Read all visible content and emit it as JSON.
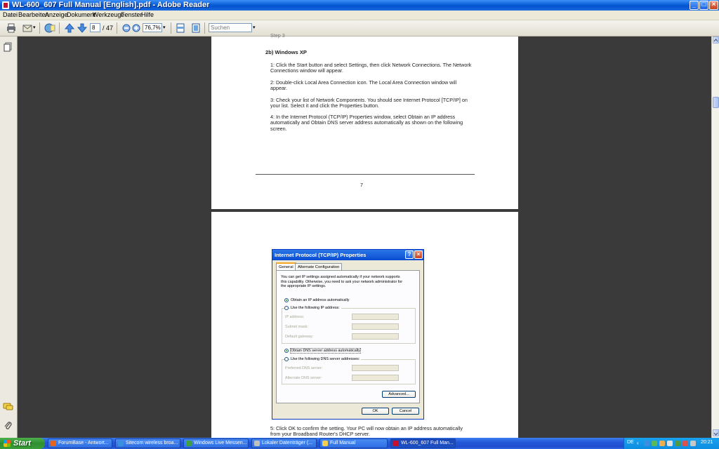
{
  "window": {
    "title": "WL-600_607 Full Manual [English].pdf - Adobe Reader",
    "minimize": "_",
    "maximize": "□",
    "close": "×"
  },
  "menu": [
    "Datei",
    "Bearbeiten",
    "Anzeige",
    "Dokument",
    "Werkzeuge",
    "Fenster",
    "Hilfe"
  ],
  "toolbar": {
    "page_current": "8",
    "page_total": "/ 47",
    "zoom": "76,7%",
    "search_placeholder": "Suchen",
    "dropdown_arrow": "▾"
  },
  "document": {
    "clipped_top": "Step 3",
    "section_heading": "2b) Windows XP",
    "steps": [
      "1: Click the Start button and select Settings, then click Network Connections. The Network Connections  window will appear.",
      "2: Double-click Local Area Connection icon. The Local Area  Connection window will appear.",
      "3: Check your list of Network Components. You should see Internet Protocol [TCP/IP] on your list. Select it and click the Properties button.",
      "4: In the Internet Protocol (TCP/IP) Properties window, select Obtain an IP address automatically and Obtain DNS server address automatically as shown on the following screen."
    ],
    "page_number": "7",
    "step5": "5: Click OK to confirm the setting. Your PC will now obtain an IP address automatically from your Broadband Router's DHCP server."
  },
  "dialog": {
    "title": "Internet Protocol (TCP/IP) Properties",
    "help": "?",
    "close": "×",
    "tabs": [
      "General",
      "Alternate Configuration"
    ],
    "description": [
      "You can get IP settings assigned automatically if your network supports",
      "this capability. Otherwise, you need to ask your network administrator for",
      "the appropriate IP settings."
    ],
    "radio_obtain_ip": "Obtain an IP address automatically",
    "radio_use_ip": "Use the following IP address:",
    "ip_address": "IP address:",
    "subnet_mask": "Subnet mask:",
    "default_gateway": "Default gateway:",
    "radio_obtain_dns": "Obtain DNS server address automatically",
    "radio_use_dns": "Use the following DNS server addresses:",
    "preferred_dns": "Preferred DNS server:",
    "alternate_dns": "Alternate DNS server:",
    "advanced": "Advanced...",
    "ok": "OK",
    "cancel": "Cancel"
  },
  "taskbar": {
    "start": "Start",
    "tasks": [
      {
        "label": "ForumBase - Antwort...",
        "color": "#e8641c"
      },
      {
        "label": "Sitecom wireless broa...",
        "color": "#3a8fe0"
      },
      {
        "label": "Windows Live Messen...",
        "color": "#40a040"
      },
      {
        "label": "Lokaler Datenträger (...",
        "color": "#c0c0c0"
      },
      {
        "label": "Full Manual",
        "color": "#f2cf52"
      },
      {
        "label": "WL-600_607 Full Man...",
        "color": "#c8102e"
      }
    ],
    "lang": "DE",
    "clock": "20:21"
  }
}
